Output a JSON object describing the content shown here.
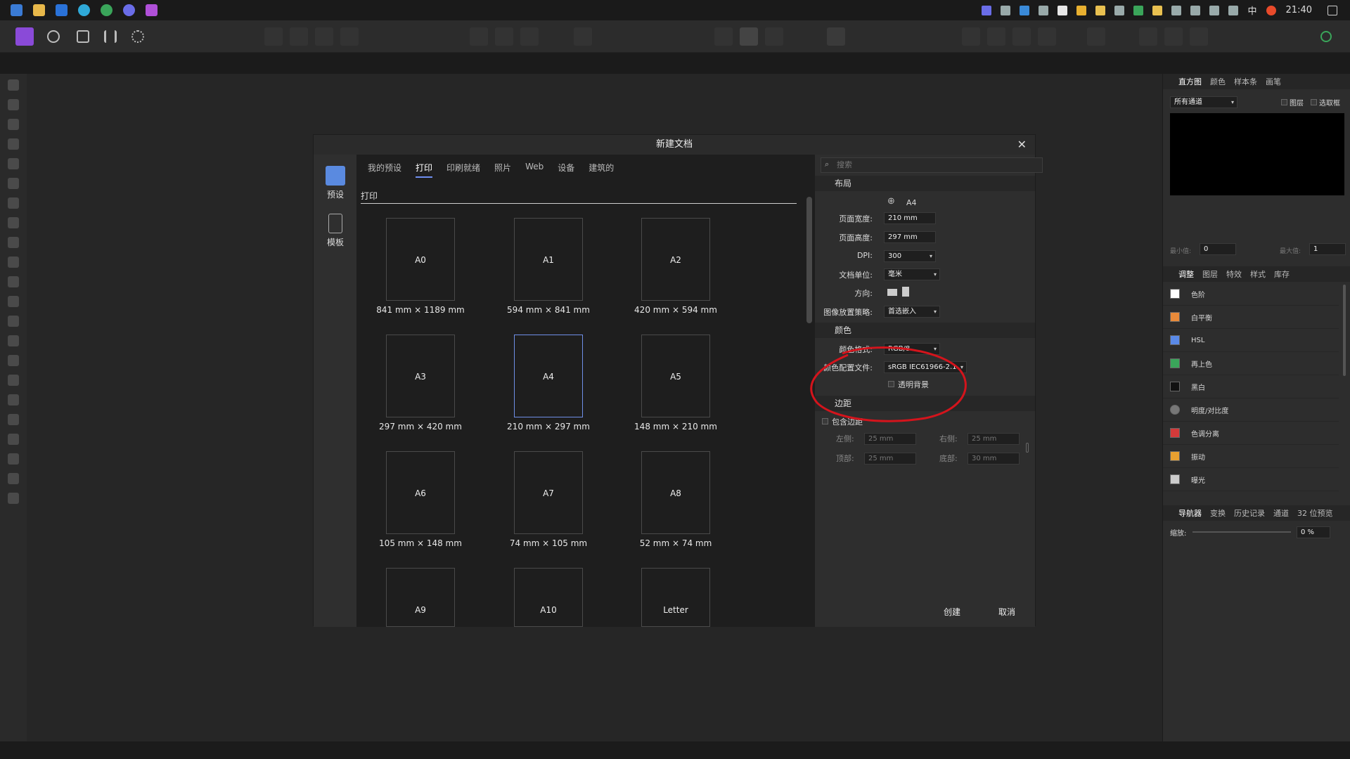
{
  "taskbar": {
    "time": "21:40",
    "ime": "中"
  },
  "dialog": {
    "title": "新建文档",
    "close": "✕",
    "side": [
      {
        "label": "预设"
      },
      {
        "label": "模板"
      }
    ],
    "tabs": [
      "我的预设",
      "打印",
      "印刷就绪",
      "照片",
      "Web",
      "设备",
      "建筑的"
    ],
    "active_tab": "打印",
    "section_label": "打印",
    "presets": [
      {
        "name": "A0",
        "size": "841 mm × 1189 mm"
      },
      {
        "name": "A1",
        "size": "594 mm × 841 mm"
      },
      {
        "name": "A2",
        "size": "420 mm × 594 mm"
      },
      {
        "name": "A3",
        "size": "297 mm × 420 mm"
      },
      {
        "name": "A4",
        "size": "210 mm × 297 mm"
      },
      {
        "name": "A5",
        "size": "148 mm × 210 mm"
      },
      {
        "name": "A6",
        "size": "105 mm × 148 mm"
      },
      {
        "name": "A7",
        "size": "74 mm × 105 mm"
      },
      {
        "name": "A8",
        "size": "52 mm × 74 mm"
      },
      {
        "name": "A9",
        "size": ""
      },
      {
        "name": "A10",
        "size": ""
      },
      {
        "name": "Letter",
        "size": ""
      }
    ],
    "selected_preset": "A4",
    "search_placeholder": "搜索",
    "layout": {
      "header": "布局",
      "preset_name": "A4",
      "page_width_label": "页面宽度:",
      "page_width": "210 mm",
      "page_height_label": "页面高度:",
      "page_height": "297 mm",
      "dpi_label": "DPI:",
      "dpi": "300",
      "unit_label": "文档单位:",
      "unit": "毫米",
      "orientation_label": "方向:",
      "placement_label": "图像放置策略:",
      "placement": "首选嵌入"
    },
    "color": {
      "header": "颜色",
      "format_label": "颜色格式:",
      "format": "RGB/8",
      "profile_label": "颜色配置文件:",
      "profile": "sRGB IEC61966-2.1",
      "transparent_label": "透明背景"
    },
    "margins": {
      "header": "边距",
      "include_label": "包含边距",
      "left_label": "左侧:",
      "left": "25 mm",
      "right_label": "右侧:",
      "right": "25 mm",
      "top_label": "顶部:",
      "top": "25 mm",
      "bottom_label": "底部:",
      "bottom": "30 mm"
    },
    "buttons": {
      "create": "创建",
      "cancel": "取消"
    }
  },
  "right_panel": {
    "top_tabs": [
      "直方图",
      "颜色",
      "样本条",
      "画笔"
    ],
    "channel": "所有通道",
    "layer_label": "图层",
    "marquee_label": "选取框",
    "min_label": "最小值:",
    "min": "0",
    "max_label": "最大值:",
    "max": "1",
    "adj_tabs": [
      "调整",
      "图层",
      "特效",
      "样式",
      "库存"
    ],
    "adjustments": [
      "色阶",
      "白平衡",
      "HSL",
      "再上色",
      "黑白",
      "明度/对比度",
      "色调分离",
      "振动",
      "曝光"
    ],
    "nav_tabs": [
      "导航器",
      "变换",
      "历史记录",
      "通道",
      "32 位预览"
    ],
    "zoom_label": "缩放:",
    "zoom": "0 %"
  },
  "colors": {
    "accent": "#6f8ff0",
    "annotation": "#d4141c"
  }
}
